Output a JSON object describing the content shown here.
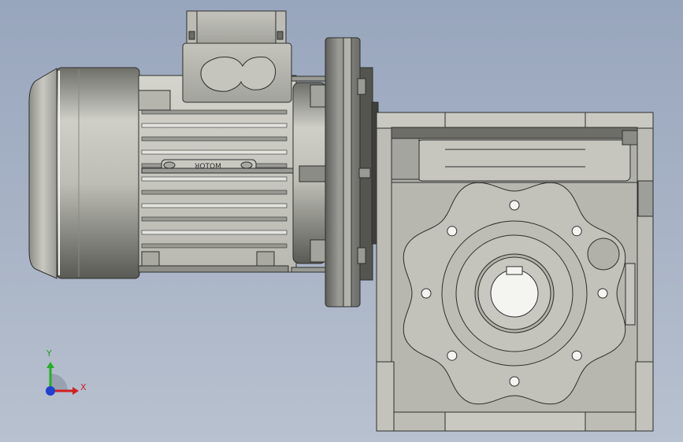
{
  "viewport": {
    "background": [
      "#98a6bd",
      "#b8c1cf"
    ],
    "model_name": "worm-gear-motor"
  },
  "triad": {
    "x_label": "X",
    "y_label": "Y",
    "z_label": "",
    "x_color": "#d02020",
    "y_color": "#22b022",
    "z_color": "#2040d0"
  },
  "motor": {
    "nameplate_text": "ꓤOTOM"
  },
  "colors": {
    "metal_light": "#d6d6cf",
    "metal_mid": "#a9a9a2",
    "metal_dark": "#4c4c48",
    "edge": "#2e2e2c"
  }
}
